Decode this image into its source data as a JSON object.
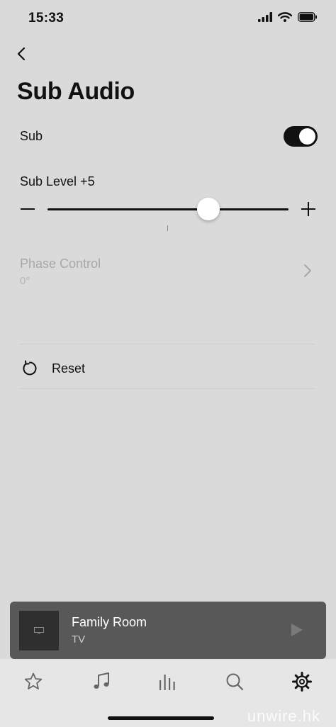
{
  "status_bar": {
    "time": "15:33"
  },
  "page": {
    "title": "Sub Audio"
  },
  "sub": {
    "label": "Sub",
    "enabled": true
  },
  "sub_level": {
    "label": "Sub Level +5",
    "value": 5,
    "min": -15,
    "max": 15
  },
  "phase_control": {
    "title": "Phase Control",
    "value": "0°"
  },
  "reset": {
    "label": "Reset"
  },
  "mini_player": {
    "room": "Family Room",
    "source": "TV"
  },
  "tabs": [
    "favorites-icon",
    "music-icon",
    "rooms-icon",
    "search-icon",
    "settings-icon"
  ],
  "watermark": "unwire.hk"
}
